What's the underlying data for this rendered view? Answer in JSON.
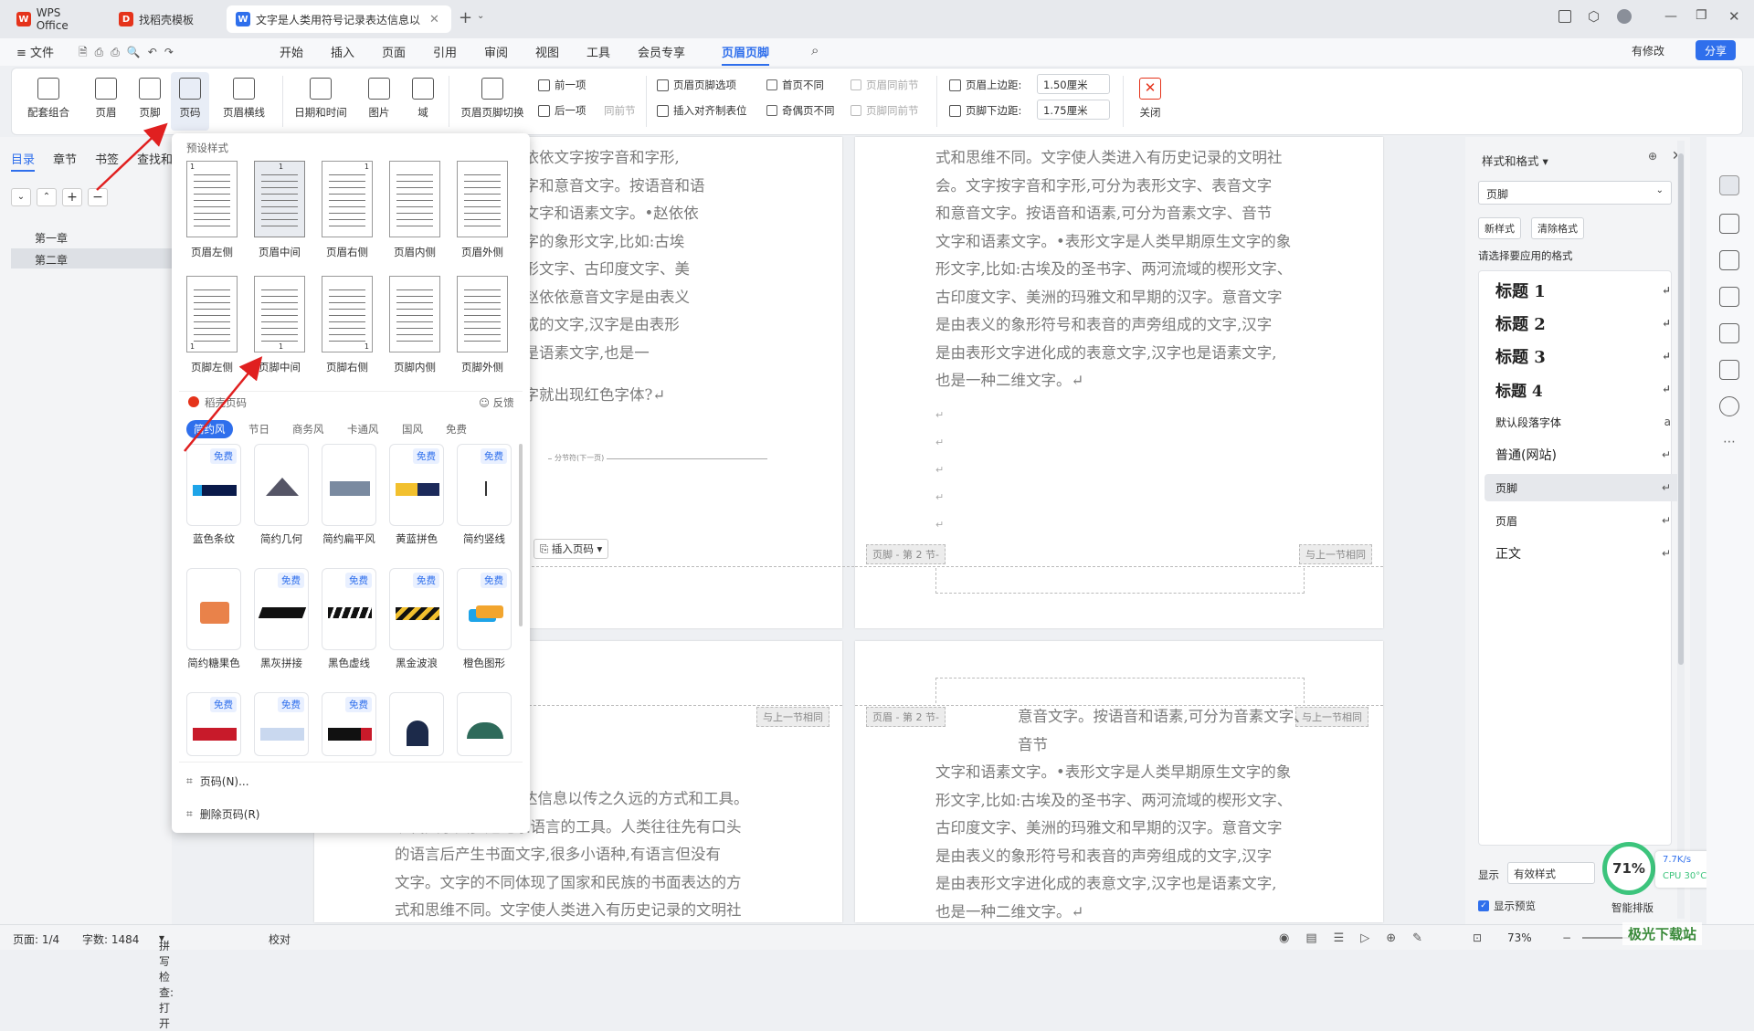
{
  "tabs": [
    {
      "label": "WPS Office",
      "color": "#e5331b"
    },
    {
      "label": "找稻壳模板",
      "color": "#e5331b"
    },
    {
      "label": "文字是人类用符号记录表达信息以",
      "color": "#2f6fec"
    }
  ],
  "menu": [
    "≡ 文件",
    "开始",
    "插入",
    "页面",
    "引用",
    "审阅",
    "视图",
    "工具",
    "会员专享",
    "页眉页脚"
  ],
  "top_right": {
    "modified": "有修改",
    "share": "分享"
  },
  "ribbon": {
    "buttons": [
      "配套组合",
      "页眉",
      "页脚",
      "页码",
      "页眉横线",
      "日期和时间",
      "图片",
      "域",
      "页眉页脚切换"
    ],
    "nav": [
      "前一项",
      "后一项",
      "同前节"
    ],
    "options": [
      "页眉页脚选项",
      "插入对齐制表位",
      "首页不同",
      "奇偶页不同",
      "页眉同前节",
      "页脚同前节"
    ],
    "header_top_label": "页眉上边距:",
    "header_top_value": "1.50厘米",
    "footer_bottom_label": "页脚下边距:",
    "footer_bottom_value": "1.75厘米",
    "close": "关闭"
  },
  "left_pane": {
    "tabs": [
      "目录",
      "章节",
      "书签",
      "查找和"
    ],
    "items": [
      "第一章",
      "第二章"
    ]
  },
  "dropdown": {
    "preset_title": "预设样式",
    "presets_header": [
      "页眉左侧",
      "页眉中间",
      "页眉右侧",
      "页眉内侧",
      "页眉外侧"
    ],
    "presets_footer": [
      "页脚左侧",
      "页脚中间",
      "页脚右侧",
      "页脚内侧",
      "页脚外侧"
    ],
    "daoke_title": "稻壳页码",
    "feedback": "反馈",
    "categories": [
      "简约风",
      "节日",
      "商务风",
      "卡通风",
      "国风",
      "免费"
    ],
    "free": "免费",
    "row1": [
      "蓝色条纹",
      "简约几何",
      "简约扁平风",
      "黄蓝拼色",
      "简约竖线"
    ],
    "row2": [
      "简约糖果色",
      "黑灰拼接",
      "黑色虚线",
      "黑金波浪",
      "橙色图形"
    ],
    "page_number_item": "页码(N)...",
    "delete_item": "删除页码(R)"
  },
  "doc": {
    "p1_lines": [
      "会。赵依依文字按字音和字形,",
      "表音文字和意音文字。按语音和语",
      "、音节文字和语素文字。•赵依依",
      "原生文字的象形文字,比如:古埃",
      "域的楔形文字、古印度文字、美",
      "汉字。赵依依意音文字是由表义",
      "声旁组成的文字,汉字是由表形",
      "汉字也是语素文字,也是一",
      "档一打字就出现红色字体?↵"
    ],
    "section_break": "分节符(下一页)",
    "insert_page_number": "插入页码",
    "p2_lines": [
      "式和思维不同。文字使人类进入有历史记录的文明社",
      "会。文字按字音和字形,可分为表形文字、表音文字",
      "和意音文字。按语音和语素,可分为音素文字、音节",
      "文字和语素文字。•表形文字是人类早期原生文字的象",
      "形文字,比如:古埃及的圣书字、两河流域的楔形文字、",
      "古印度文字、美洲的玛雅文和早期的汉字。意音文字",
      "是由表义的象形符号和表音的声旁组成的文字,汉字",
      "是由表形文字进化成的表意文字,汉字也是语素文字,",
      "也是一种二维文字。↵"
    ],
    "footer_tag": "页脚 - 第 2 节-",
    "same_as_prev": "与上一节相同",
    "header_tag": "页眉 - 第 2 节-",
    "p3_lines": [
      "达信息以传之久远的方式和工具。",
      "现代文字大多是记录语言的工具。人类往往先有口头",
      "的语言后产生书面文字,很多小语种,有语言但没有",
      "文字。文字的不同体现了国家和民族的书面表达的方",
      "式和思维不同。文字使人类进入有历史记录的文明社"
    ],
    "p4_lines": [
      "意音文字。按语音和语素,可分为音素文字、音节",
      "文字和语素文字。•表形文字是人类早期原生文字的象",
      "形文字,比如:古埃及的圣书字、两河流域的楔形文字、",
      "古印度文字、美洲的玛雅文和早期的汉字。意音文字",
      "是由表义的象形符号和表音的声旁组成的文字,汉字",
      "是由表形文字进化成的表意文字,汉字也是语素文字,",
      "也是一种二维文字。↵"
    ]
  },
  "right_pane": {
    "title": "样式和格式",
    "current": "页脚",
    "new_style": "新样式",
    "clear_format": "清除格式",
    "hint": "请选择要应用的格式",
    "styles": [
      "标题 1",
      "标题 2",
      "标题 3",
      "标题 4",
      "默认段落字体",
      "普通(网站)",
      "页脚",
      "页眉",
      "正文"
    ],
    "show_label": "显示",
    "show_value": "有效样式",
    "preview": "显示预览",
    "smart": "智能排版"
  },
  "widget": {
    "percent": "71%",
    "speed": "7.7K/s",
    "cpu": "CPU 30°C"
  },
  "status": {
    "page": "页面: 1/4",
    "words": "字数: 1484",
    "spell": "拼写检查: 打开",
    "proof": "校对",
    "zoom": "73%"
  },
  "watermark": "极光下载站"
}
